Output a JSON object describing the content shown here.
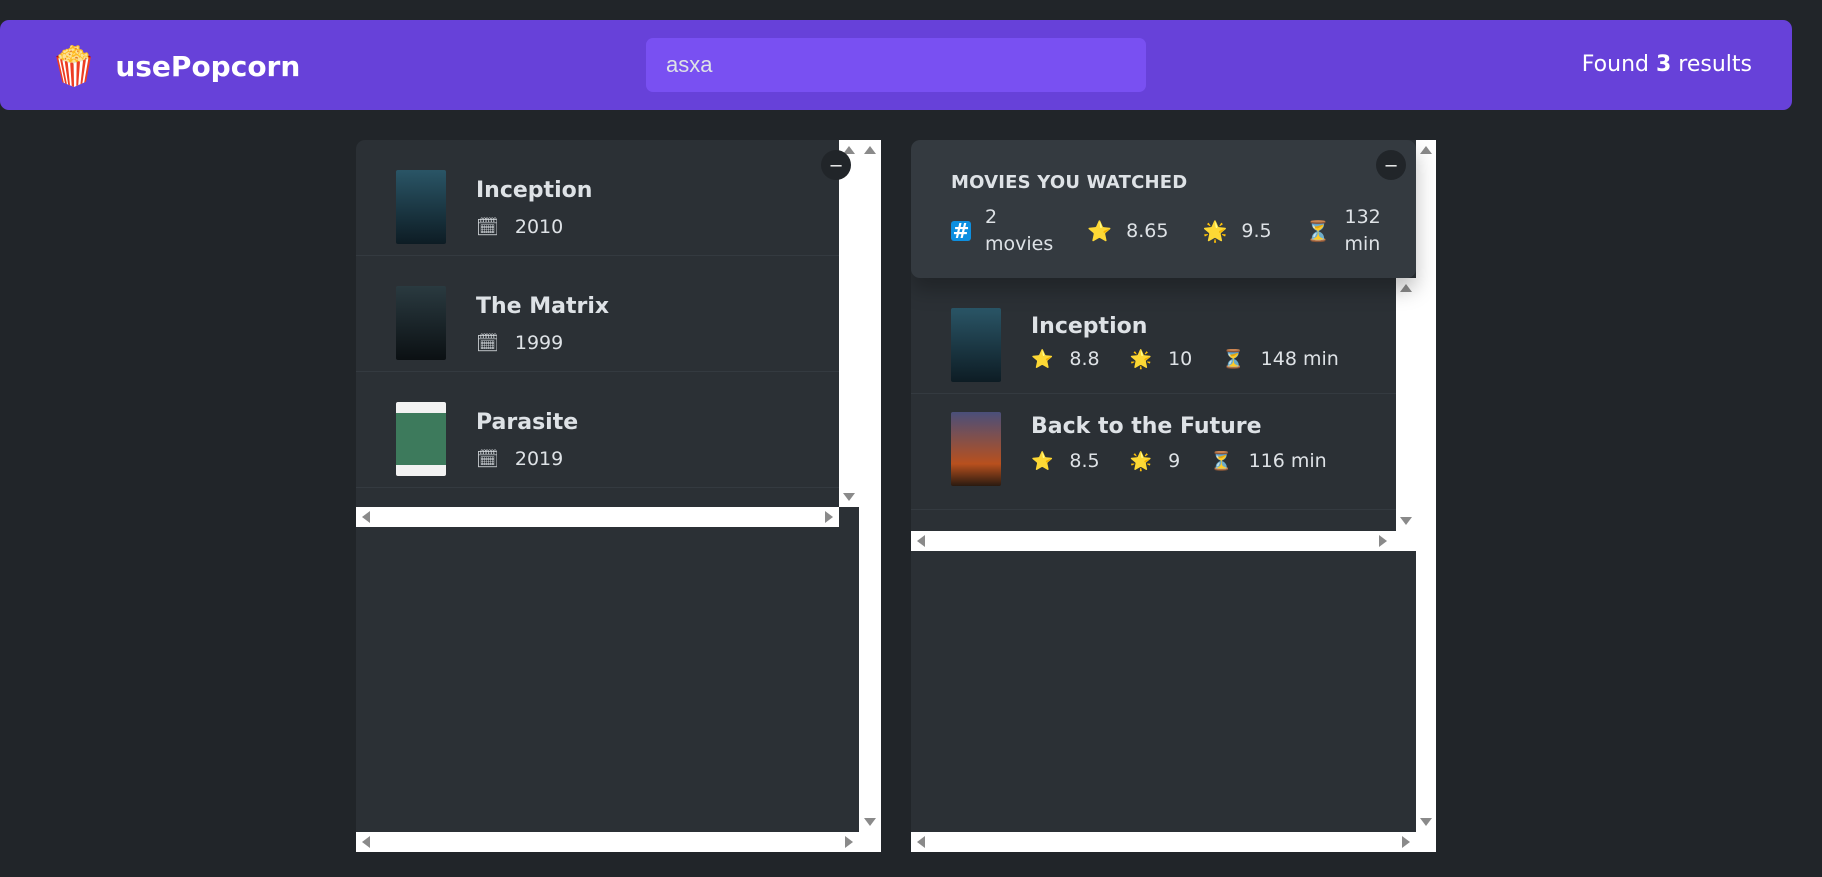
{
  "nav": {
    "logo_icon": "popcorn-icon",
    "logo_glyph": "🍿",
    "logo_text": "usePopcorn",
    "search_value": "asxa",
    "results_prefix": "Found ",
    "results_count": "3",
    "results_suffix": " results"
  },
  "toggle_label": "–",
  "search_results": [
    {
      "title": "Inception",
      "year": "2010",
      "calendar_icon": "🗓",
      "poster_color": "#1b3a4a"
    },
    {
      "title": "The Matrix",
      "year": "1999",
      "calendar_icon": "🗓",
      "poster_color": "#1a2a30"
    },
    {
      "title": "Parasite",
      "year": "2019",
      "calendar_icon": "🗓",
      "poster_color": "#2f6b4f"
    }
  ],
  "summary": {
    "heading": "MOVIES YOU WATCHED",
    "count_line1": "2",
    "count_line2": "movies",
    "imdb_avg": "8.65",
    "user_avg": "9.5",
    "runtime_line1": "132",
    "runtime_line2": "min",
    "icons": {
      "hash": "#",
      "star": "⭐",
      "sun": "🌟",
      "hourglass": "⏳"
    }
  },
  "watched": [
    {
      "title": "Inception",
      "imdb": "8.8",
      "user": "10",
      "runtime": "148 min",
      "poster_color": "#1b3a4a"
    },
    {
      "title": "Back to the Future",
      "imdb": "8.5",
      "user": "9",
      "runtime": "116 min",
      "poster_color": "#8a3b1f"
    }
  ],
  "colors": {
    "nav": "#6741d9",
    "search": "#7950f2",
    "background": "#212529",
    "box": "#2b3035"
  }
}
